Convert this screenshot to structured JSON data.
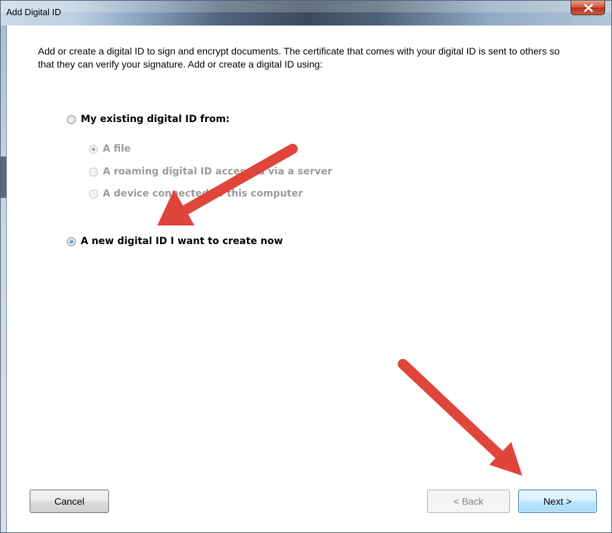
{
  "window": {
    "title": "Add Digital ID"
  },
  "intro_text": "Add or create a digital ID to sign and encrypt documents. The certificate that comes with your digital ID is sent to others so that they can verify your signature. Add or create a digital ID using:",
  "options": {
    "existing": {
      "label": "My existing digital ID from:",
      "selected": false
    },
    "sub": [
      {
        "label": "A file",
        "selected": true,
        "enabled": false
      },
      {
        "label": "A roaming digital ID accessed via a server",
        "selected": false,
        "enabled": false
      },
      {
        "label": "A device connected to this computer",
        "selected": false,
        "enabled": false
      }
    ],
    "new": {
      "label": "A new digital ID I want to create now",
      "selected": true
    }
  },
  "buttons": {
    "cancel": "Cancel",
    "back": "< Back",
    "next": "Next >"
  },
  "annotation": {
    "arrow_color": "#e0453b"
  }
}
